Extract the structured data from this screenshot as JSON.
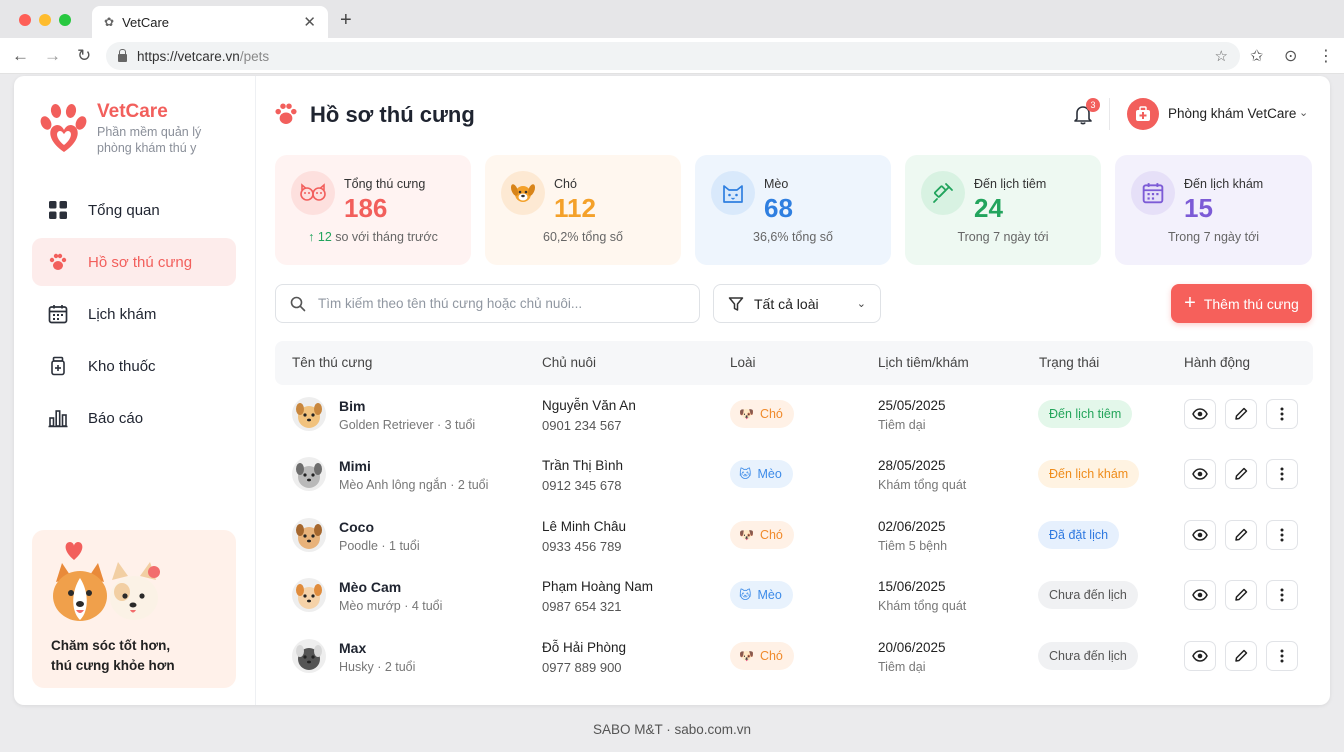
{
  "browser": {
    "tab_title": "VetCare",
    "url_host": "https://vetcare.vn",
    "url_path": "/pets"
  },
  "sidebar": {
    "brand": "VetCare",
    "brand_sub": "Phần mềm quản lý phòng khám thú y",
    "items": [
      {
        "label": "Tổng quan",
        "icon": "grid-icon"
      },
      {
        "label": "Hồ sơ thú cưng",
        "icon": "paw-icon",
        "active": true
      },
      {
        "label": "Lịch khám",
        "icon": "calendar-icon"
      },
      {
        "label": "Kho thuốc",
        "icon": "medicine-bottle-icon"
      },
      {
        "label": "Báo cáo",
        "icon": "bar-chart-icon"
      }
    ],
    "promo_line1": "Chăm sóc tốt hơn,",
    "promo_line2": "thú cưng khỏe hơn"
  },
  "header": {
    "title": "Hồ sơ thú cưng",
    "notification_count": "3",
    "clinic_name": "Phòng khám VetCare"
  },
  "stats": [
    {
      "label": "Tổng thú cưng",
      "value": "186",
      "sub_highlight": "↑ 12",
      "sub": " so với tháng trước",
      "color": "#f25f5c",
      "bg": "#fff3f2"
    },
    {
      "label": "Chó",
      "value": "112",
      "sub_highlight": "",
      "sub": "60,2% tổng số",
      "color": "#f4a12a",
      "bg": "#fff7ef"
    },
    {
      "label": "Mèo",
      "value": "68",
      "sub_highlight": "",
      "sub": "36,6% tổng số",
      "color": "#2f7fe0",
      "bg": "#eef5fd"
    },
    {
      "label": "Đến lịch tiêm",
      "value": "24",
      "sub_highlight": "",
      "sub": "Trong 7 ngày tới",
      "color": "#22a45d",
      "bg": "#eef9f2"
    },
    {
      "label": "Đến lịch khám",
      "value": "15",
      "sub_highlight": "",
      "sub": "Trong 7 ngày tới",
      "color": "#7c5bd6",
      "bg": "#f3f1fc"
    }
  ],
  "toolbar": {
    "search_placeholder": "Tìm kiếm theo tên thú cưng hoặc chủ nuôi...",
    "filter_label": "Tất cả loài",
    "add_label": "Thêm thú cưng"
  },
  "table": {
    "headers": [
      "Tên thú cưng",
      "Chủ nuôi",
      "Loài",
      "Lịch tiêm/khám",
      "Trạng thái",
      "Hành động"
    ],
    "rows": [
      {
        "name": "Bim",
        "info": "Golden Retriever · 3 tuổi",
        "owner": "Nguyễn Văn An",
        "phone": "0901 234 567",
        "species": "Chó",
        "date": "25/05/2025",
        "note": "Tiêm dại",
        "status": "Đến lịch tiêm"
      },
      {
        "name": "Mimi",
        "info": "Mèo Anh lông ngắn · 2 tuổi",
        "owner": "Trần Thị Bình",
        "phone": "0912 345 678",
        "species": "Mèo",
        "date": "28/05/2025",
        "note": "Khám tổng quát",
        "status": "Đến lịch khám"
      },
      {
        "name": "Coco",
        "info": "Poodle · 1 tuổi",
        "owner": "Lê Minh Châu",
        "phone": "0933 456 789",
        "species": "Chó",
        "date": "02/06/2025",
        "note": "Tiêm 5 bệnh",
        "status": "Đã đặt lịch"
      },
      {
        "name": "Mèo Cam",
        "info": "Mèo mướp · 4 tuổi",
        "owner": "Phạm Hoàng Nam",
        "phone": "0987 654 321",
        "species": "Mèo",
        "date": "15/06/2025",
        "note": "Khám tổng quát",
        "status": "Chưa đến lịch"
      },
      {
        "name": "Max",
        "info": "Husky · 2 tuổi",
        "owner": "Đỗ Hải Phòng",
        "phone": "0977 889 900",
        "species": "Chó",
        "date": "20/06/2025",
        "note": "Tiêm dại",
        "status": "Chưa đến lịch"
      }
    ]
  },
  "footer": "SABO M&T · sabo.com.vn"
}
